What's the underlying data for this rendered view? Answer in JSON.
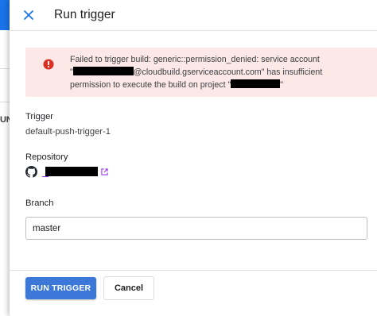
{
  "background": {
    "truncated_text": "UN"
  },
  "header": {
    "title": "Run trigger"
  },
  "error": {
    "line1": "Failed to trigger build: generic::permission_denied: service account",
    "line2_after_redaction": "@cloudbuild.gserviceaccount.com\" has insufficient",
    "line3_before_redaction": "permission to execute the build on project \"",
    "line3_after_redaction": "\"",
    "line2_before_redaction": "\""
  },
  "trigger": {
    "label": "Trigger",
    "value": "default-push-trigger-1"
  },
  "repository": {
    "label": "Repository"
  },
  "branch": {
    "label": "Branch",
    "value": "master"
  },
  "footer": {
    "run_label": "RUN TRIGGER",
    "cancel_label": "Cancel"
  },
  "colors": {
    "primary": "#3c78d8",
    "error_bg": "#fce8e6",
    "error_icon": "#d93025",
    "close_icon": "#1a73e8",
    "link": "#9334e6"
  }
}
